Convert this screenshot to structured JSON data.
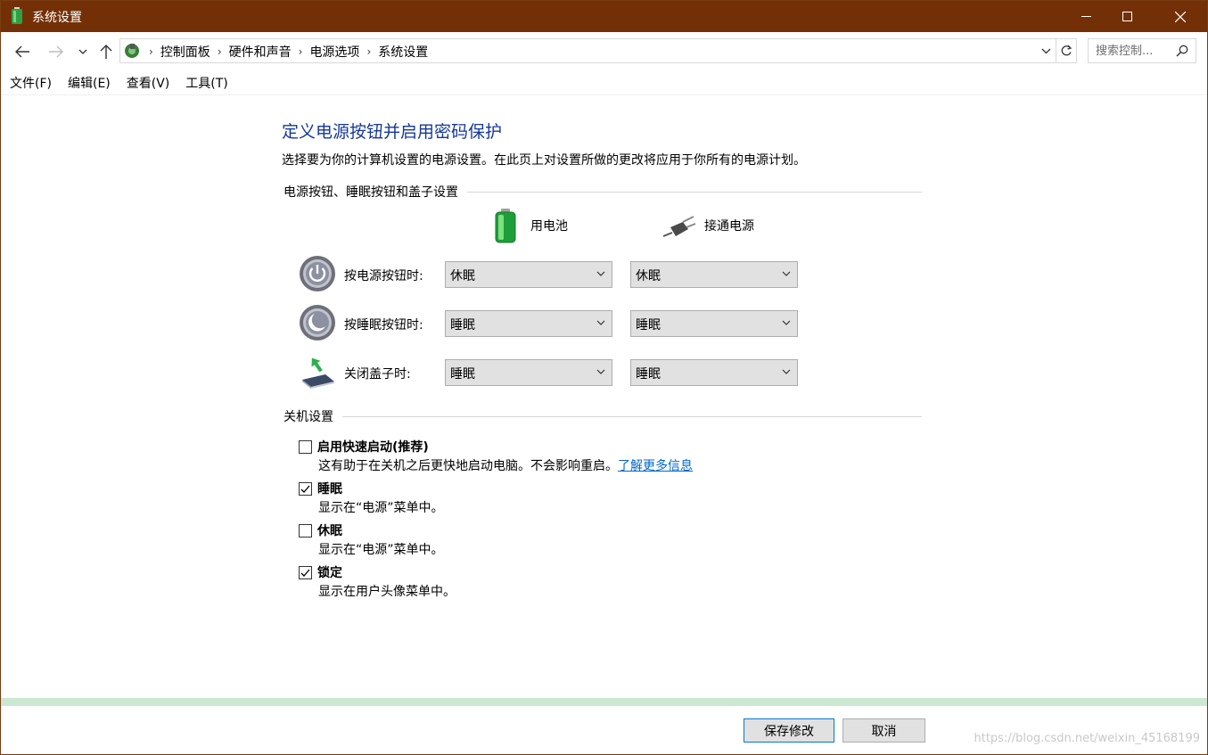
{
  "window": {
    "title": "系统设置",
    "controls": {
      "minimize": "minimize",
      "maximize": "maximize",
      "close": "close"
    },
    "title_color": "#733007"
  },
  "address": {
    "breadcrumbs": [
      "控制面板",
      "硬件和声音",
      "电源选项",
      "系统设置"
    ],
    "search_placeholder": "搜索控制..."
  },
  "menu": [
    "文件(F)",
    "编辑(E)",
    "查看(V)",
    "工具(T)"
  ],
  "page": {
    "title": "定义电源按钮并启用密码保护",
    "description": "选择要为你的计算机设置的电源设置。在此页上对设置所做的更改将应用于你所有的电源计划。"
  },
  "buttons_section": {
    "heading": "电源按钮、睡眠按钮和盖子设置",
    "columns": {
      "battery": "用电池",
      "plugged_in": "接通电源"
    },
    "rows": [
      {
        "label": "按电源按钮时:",
        "icon": "power-button-icon",
        "battery": "休眠",
        "plugged_in": "休眠"
      },
      {
        "label": "按睡眠按钮时:",
        "icon": "sleep-button-icon",
        "battery": "睡眠",
        "plugged_in": "睡眠"
      },
      {
        "label": "关闭盖子时:",
        "icon": "laptop-lid-icon",
        "battery": "睡眠",
        "plugged_in": "睡眠"
      }
    ]
  },
  "shutdown_section": {
    "heading": "关机设置",
    "options": [
      {
        "label": "启用快速启动(推荐)",
        "checked": false,
        "desc": "这有助于在关机之后更快地启动电脑。不会影响重启。",
        "link": "了解更多信息"
      },
      {
        "label": "睡眠",
        "checked": true,
        "desc": "显示在“电源”菜单中。"
      },
      {
        "label": "休眠",
        "checked": false,
        "desc": "显示在“电源”菜单中。"
      },
      {
        "label": "锁定",
        "checked": true,
        "desc": "显示在用户头像菜单中。"
      }
    ]
  },
  "footer": {
    "save": "保存修改",
    "cancel": "取消",
    "watermark": "https://blog.csdn.net/weixin_45168199"
  }
}
